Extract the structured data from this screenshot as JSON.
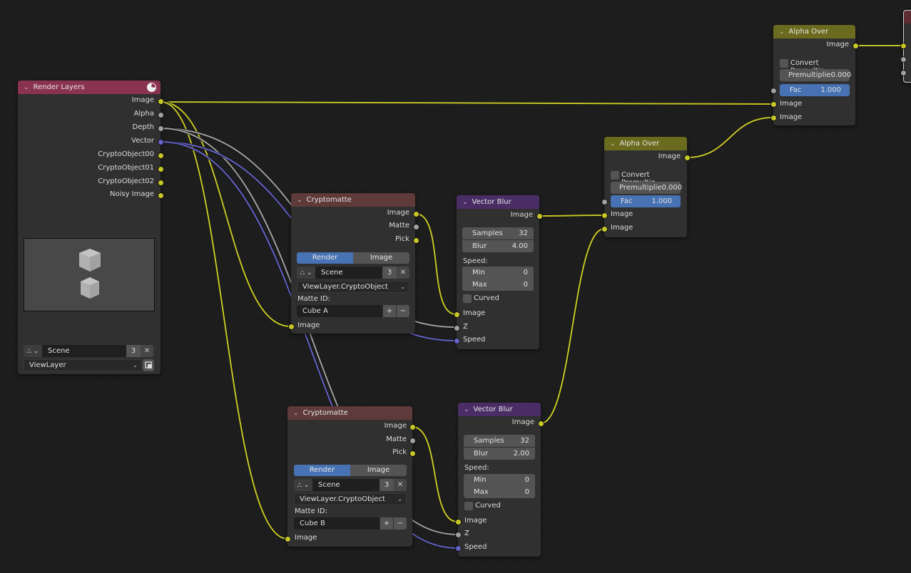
{
  "colors": {
    "background": "#1d1d1d",
    "render_layers_header": "#8a3350",
    "cryptomatte_header": "#5e3a3a",
    "vector_blur_header": "#4b2d66",
    "alpha_over_header": "#6b6b1f",
    "socket_color": "#c7c729",
    "socket_float": "#a1a1a1",
    "socket_vector": "#6363c7",
    "accent_blue": "#4772b3"
  },
  "render_layers": {
    "title": "Render Layers",
    "outputs": [
      "Image",
      "Alpha",
      "Depth",
      "Vector",
      "CryptoObject00",
      "CryptoObject01",
      "CryptoObject02",
      "Noisy Image"
    ],
    "scene": {
      "name": "Scene",
      "users": "3"
    },
    "view_layer": "ViewLayer"
  },
  "cryptomatte_a": {
    "title": "Cryptomatte",
    "outputs": [
      "Image",
      "Matte",
      "Pick"
    ],
    "source_tabs": [
      "Render",
      "Image"
    ],
    "active_tab": "Render",
    "scene": {
      "name": "Scene",
      "users": "3"
    },
    "layer": "ViewLayer.CryptoObject",
    "matte_id_label": "Matte ID:",
    "matte_id": "Cube A",
    "input": "Image"
  },
  "cryptomatte_b": {
    "title": "Cryptomatte",
    "outputs": [
      "Image",
      "Matte",
      "Pick"
    ],
    "source_tabs": [
      "Render",
      "Image"
    ],
    "active_tab": "Render",
    "scene": {
      "name": "Scene",
      "users": "3"
    },
    "layer": "ViewLayer.CryptoObject",
    "matte_id_label": "Matte ID:",
    "matte_id": "Cube B",
    "input": "Image"
  },
  "vector_blur_a": {
    "title": "Vector Blur",
    "output": "Image",
    "samples_label": "Samples",
    "samples": "32",
    "blur_label": "Blur",
    "blur": "4.00",
    "speed_label": "Speed:",
    "min_label": "Min",
    "min": "0",
    "max_label": "Max",
    "max": "0",
    "curved_label": "Curved",
    "inputs": [
      "Image",
      "Z",
      "Speed"
    ]
  },
  "vector_blur_b": {
    "title": "Vector Blur",
    "output": "Image",
    "samples_label": "Samples",
    "samples": "32",
    "blur_label": "Blur",
    "blur": "2.00",
    "speed_label": "Speed:",
    "min_label": "Min",
    "min": "0",
    "max_label": "Max",
    "max": "0",
    "curved_label": "Curved",
    "inputs": [
      "Image",
      "Z",
      "Speed"
    ]
  },
  "alpha_over_a": {
    "title": "Alpha Over",
    "output": "Image",
    "convert_label": "Convert Premultip...",
    "premul_label": "Premultiplie",
    "premul": "0.000",
    "fac_label": "Fac",
    "fac": "1.000",
    "inputs": [
      "Image",
      "Image"
    ]
  },
  "alpha_over_b": {
    "title": "Alpha Over",
    "output": "Image",
    "convert_label": "Convert Premultip...",
    "premul_label": "Premultiplie",
    "premul": "0.000",
    "fac_label": "Fac",
    "fac": "1.000",
    "inputs": [
      "Image",
      "Image"
    ]
  },
  "icons": {
    "collapse": "⌄",
    "close": "✕",
    "plus": "+",
    "minus": "−",
    "dropdown": "⌄",
    "scene_icon": "⛬"
  }
}
